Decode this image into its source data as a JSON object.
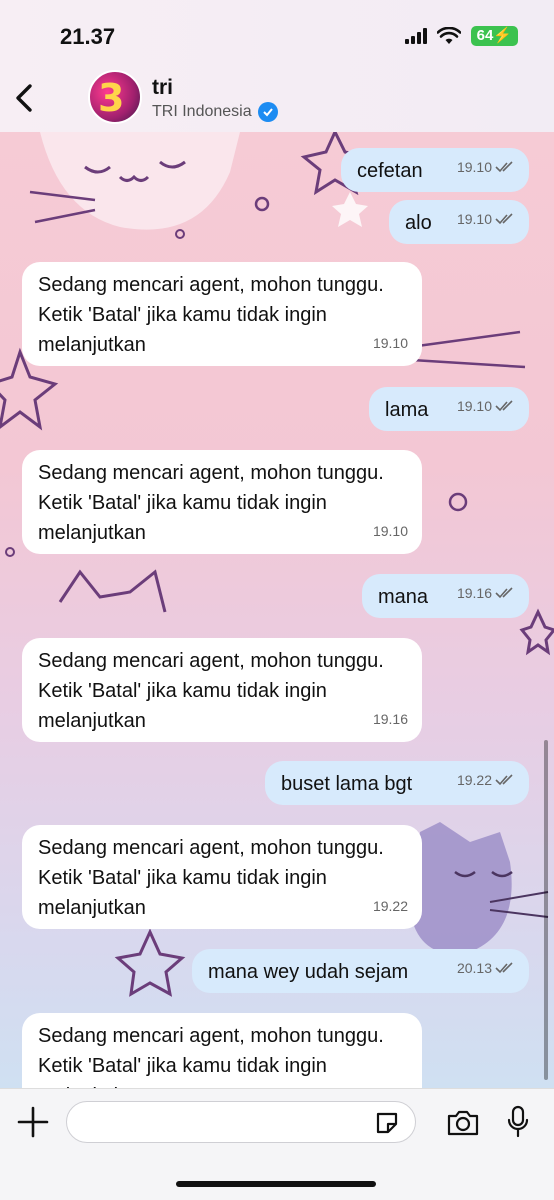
{
  "status": {
    "time": "21.37",
    "battery": "64"
  },
  "header": {
    "name": "tri",
    "subtitle": "TRI Indonesia"
  },
  "messages": [
    {
      "text": "cefetan",
      "time": "19.10"
    },
    {
      "text": "alo",
      "time": "19.10"
    },
    {
      "text": "Sedang mencari agent, mohon tunggu. Ketik 'Batal' jika kamu tidak ingin melanjutkan",
      "time": "19.10"
    },
    {
      "text": "lama",
      "time": "19.10"
    },
    {
      "text": "Sedang mencari agent, mohon tunggu. Ketik 'Batal' jika kamu tidak ingin melanjutkan",
      "time": "19.10"
    },
    {
      "text": "mana",
      "time": "19.16"
    },
    {
      "text": "Sedang mencari agent, mohon tunggu. Ketik 'Batal' jika kamu tidak ingin melanjutkan",
      "time": "19.16"
    },
    {
      "text": "buset lama bgt",
      "time": "19.22"
    },
    {
      "text": "Sedang mencari agent, mohon tunggu. Ketik 'Batal' jika kamu tidak ingin melanjutkan",
      "time": "19.22"
    },
    {
      "text": "mana wey udah sejam",
      "time": "20.13"
    },
    {
      "text": "Sedang mencari agent, mohon tunggu. Ketik 'Batal' jika kamu tidak ingin melanjutkan",
      "time": ""
    }
  ],
  "input": {
    "placeholder": ""
  },
  "colors": {
    "outgoing_bubble": "#d7eafc",
    "incoming_bubble": "#ffffff",
    "verified": "#1d8cf2",
    "battery": "#3cc24f"
  },
  "icons": [
    "chevron-left-icon",
    "verified-icon",
    "double-check-icon",
    "plus-icon",
    "sticker-icon",
    "camera-icon",
    "microphone-icon"
  ]
}
